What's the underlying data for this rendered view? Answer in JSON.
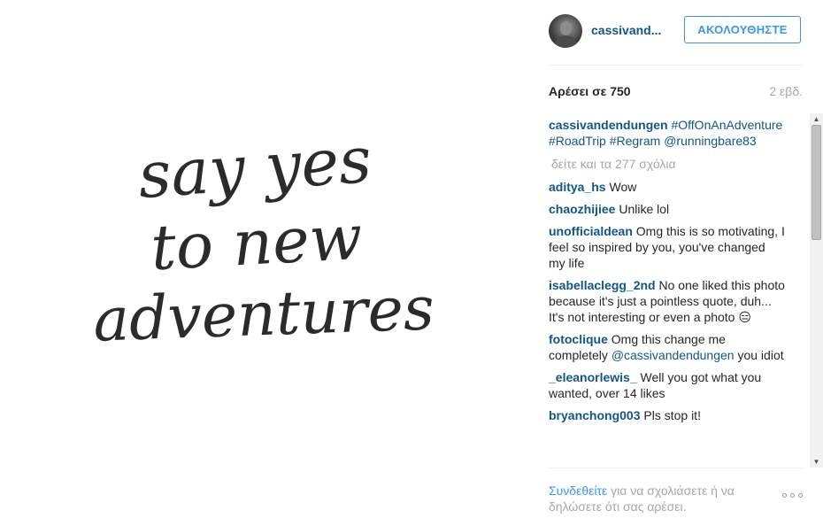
{
  "post": {
    "quote_lines": [
      "say yes",
      "to new",
      "adventures"
    ]
  },
  "header": {
    "username": "cassivand...",
    "follow_label": "ΑΚΟΛΟΥΘΗΣΤΕ"
  },
  "stats": {
    "likes": "Αρέσει σε 750",
    "time_ago": "2 εβδ."
  },
  "caption": {
    "author": "cassivandendungen",
    "text": "#OffOnAnAdventure #RoadTrip #Regram @runningbare83"
  },
  "view_all_comments": "δείτε και τα 277 σχόλια",
  "comments": [
    {
      "author": "aditya_hs",
      "text": "Wow"
    },
    {
      "author": "chaozhijiee",
      "text": "Unlike lol"
    },
    {
      "author": "unofficialdean",
      "text": "Omg this is so motivating, I feel so inspired by you, you've changed my life"
    },
    {
      "author": "isabellaclegg_2nd",
      "text": "No one liked this photo because it's just a pointless quote, duh... It's not interesting or even a photo 😑"
    },
    {
      "author": "fotoclique",
      "text_before": "Omg this change me completely",
      "mention": "@cassivandendungen",
      "text_after": "you idiot"
    },
    {
      "author": "_eleanorlewis_",
      "text": "Well you got what you wanted, over 14 likes"
    },
    {
      "author": "bryanchong003",
      "text": "Pls stop it!"
    }
  ],
  "footer": {
    "login_link": "Συνδεθείτε",
    "login_text": "για να σχολιάσετε ή να δηλώσετε ότι σας αρέσει."
  },
  "icons": {
    "more": "more-options-icon",
    "scroll_up": "scroll-up-arrow-icon",
    "scroll_down": "scroll-down-arrow-icon"
  },
  "colors": {
    "link": "#125688",
    "follow": "#3897f0",
    "muted": "#a5a7aa"
  }
}
